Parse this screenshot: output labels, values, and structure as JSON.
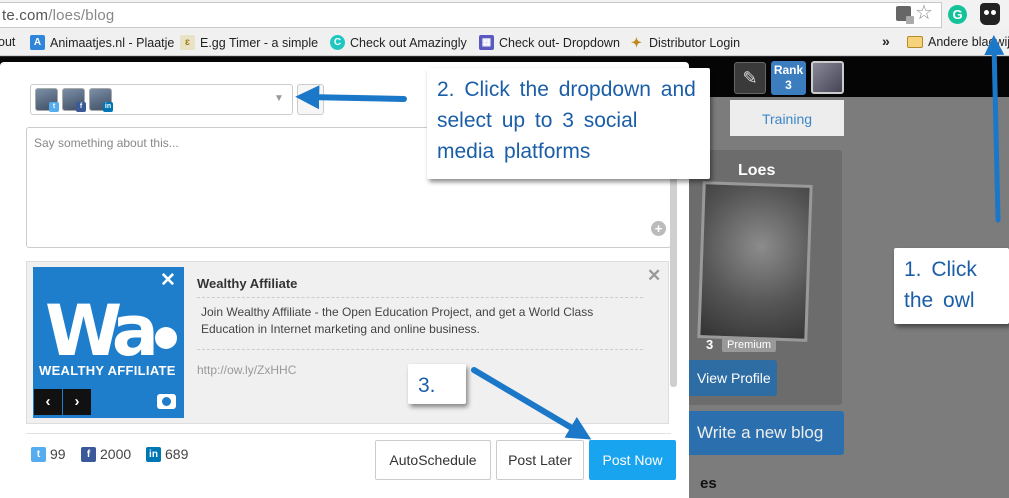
{
  "browser": {
    "url_visible": "te.com",
    "url_path": "/loes/blog"
  },
  "bookmarks": [
    {
      "label": "out"
    },
    {
      "label": "Animaatjes.nl - Plaatje"
    },
    {
      "label": "E.gg Timer - a simple"
    },
    {
      "label": "Check out Amazingly"
    },
    {
      "label": "Check out- Dropdown"
    },
    {
      "label": "Distributor Login"
    },
    {
      "label": "Andere bladwijz"
    }
  ],
  "background_page": {
    "rank_label": "Rank",
    "rank_value": "3",
    "training_tab": "Training",
    "profile_name": "Loes",
    "rank_number": "3",
    "premium_tag": "Premium",
    "view_profile": "View Profile",
    "new_blog": "Write a new blog",
    "trailing_text": "es"
  },
  "composer": {
    "message_placeholder": "Say something about this...",
    "preview": {
      "image_brand": "WEALTHY AFFILIATE",
      "title": "Wealthy Affiliate",
      "description": "Join Wealthy Affiliate - the Open Education Project, and get a World Class Education in Internet marketing and online business.",
      "url": "http://ow.ly/ZxHHC"
    },
    "counts": {
      "twitter": "99",
      "facebook": "2000",
      "linkedin": "689"
    },
    "buttons": {
      "autoschedule": "AutoSchedule",
      "post_later": "Post Later",
      "post_now": "Post Now"
    }
  },
  "callouts": {
    "step1": "1. Click the owl",
    "step2": "2. Click the dropdown and select up to 3 social media platforms",
    "step3": "3."
  },
  "colors": {
    "accent": "#18a4ef",
    "callout_text": "#1b5ea8",
    "arrow": "#1b78c8"
  }
}
